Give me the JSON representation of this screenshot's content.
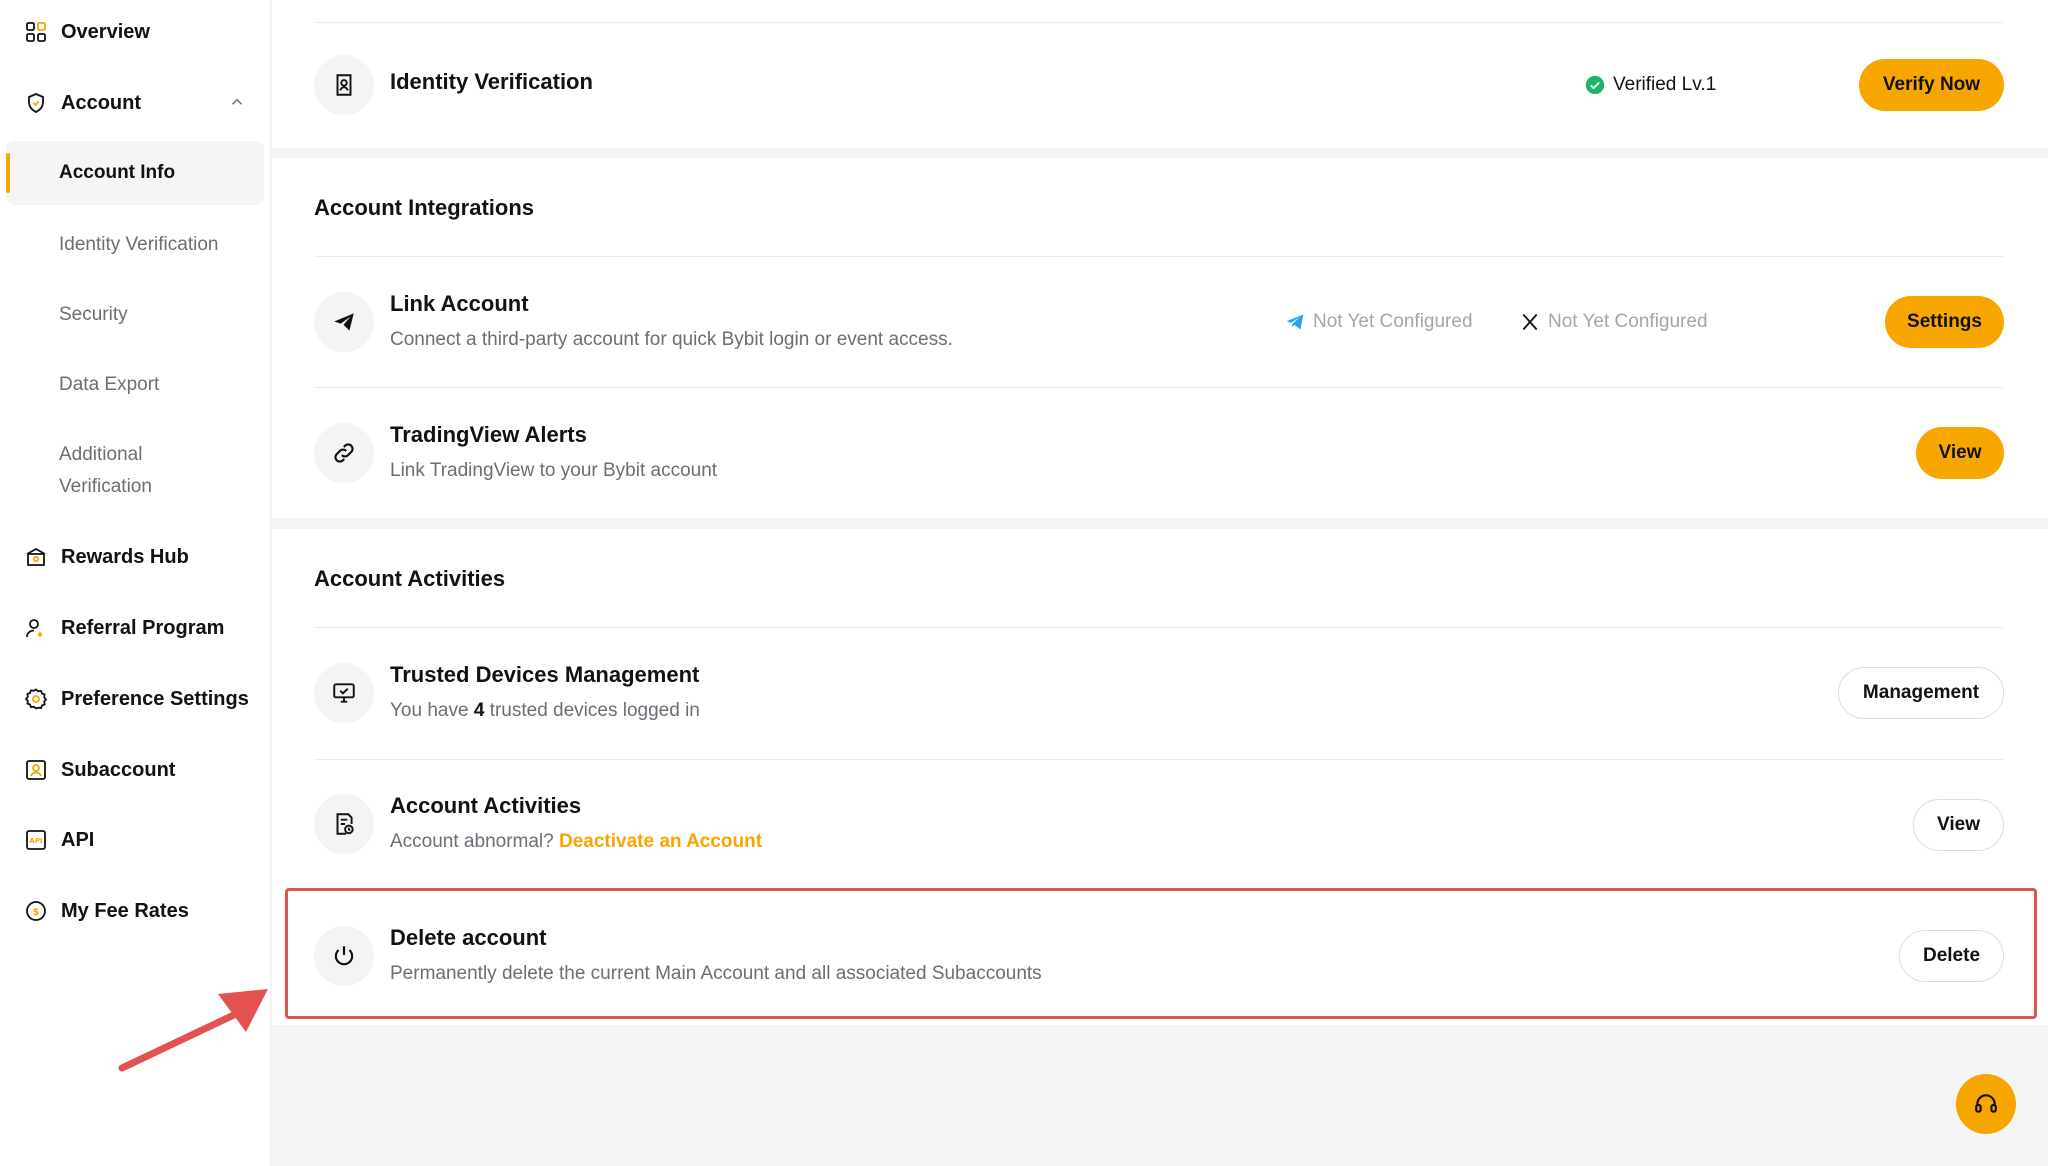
{
  "sidebar": {
    "items": [
      {
        "label": "Overview",
        "icon": "grid-icon"
      },
      {
        "label": "Account",
        "icon": "shield-icon"
      },
      {
        "label": "Rewards Hub",
        "icon": "gift-icon"
      },
      {
        "label": "Referral Program",
        "icon": "user-plus-icon"
      },
      {
        "label": "Preference Settings",
        "icon": "gear-icon"
      },
      {
        "label": "Subaccount",
        "icon": "subaccount-icon"
      },
      {
        "label": "API",
        "icon": "api-icon"
      },
      {
        "label": "My Fee Rates",
        "icon": "coin-icon"
      }
    ],
    "account_sub": [
      {
        "label": "Account Info"
      },
      {
        "label": "Identity Verification"
      },
      {
        "label": "Security"
      },
      {
        "label": "Data Export"
      },
      {
        "label": "Additional Verification"
      }
    ]
  },
  "identity": {
    "title": "Identity Verification",
    "status": "Verified Lv.1",
    "button": "Verify Now"
  },
  "integrations": {
    "title": "Account Integrations",
    "link_account": {
      "title": "Link Account",
      "desc": "Connect a third-party account for quick Bybit login or event access.",
      "telegram_status": "Not Yet Configured",
      "x_status": "Not Yet Configured",
      "button": "Settings"
    },
    "tradingview": {
      "title": "TradingView Alerts",
      "desc": "Link TradingView to your Bybit account",
      "button": "View"
    }
  },
  "activities": {
    "title": "Account Activities",
    "trusted": {
      "title": "Trusted Devices Management",
      "desc_prefix": "You have",
      "count": "4",
      "desc_suffix": "trusted devices logged in",
      "button": "Management"
    },
    "account_activities": {
      "title": "Account Activities",
      "desc_prefix": "Account abnormal?",
      "link": "Deactivate an Account",
      "button": "View"
    },
    "delete": {
      "title": "Delete account",
      "desc": "Permanently delete the current Main Account and all associated Subaccounts",
      "button": "Delete"
    }
  },
  "colors": {
    "accent": "#f7a600",
    "highlight": "#e45151",
    "verified": "#20b26c"
  }
}
